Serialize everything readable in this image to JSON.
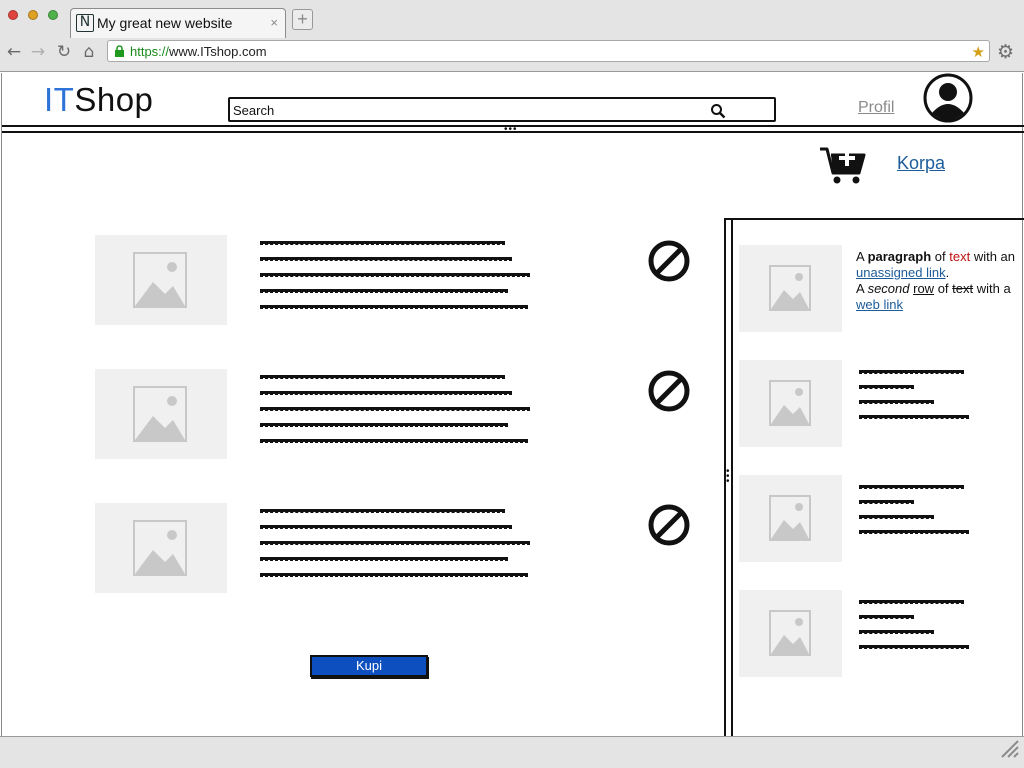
{
  "browser": {
    "tab_title": "My great new website",
    "tab_favicon_letter": "N",
    "tab_close": "×",
    "new_tab": "+",
    "url_protocol": "https://",
    "url_rest": "www.ITshop.com",
    "icons": [
      "back-icon",
      "forward-icon",
      "reload-icon",
      "home-icon",
      "lock-icon",
      "bookmark-star-icon",
      "settings-icon"
    ],
    "colors": {
      "close": "#e0443e",
      "minimize": "#dea123",
      "maximize": "#4fb14a"
    }
  },
  "header": {
    "logo_it": "IT",
    "logo_shop": "Shop",
    "search_placeholder": "Search",
    "profil_label": "Profil",
    "korpa_label": "Korpa"
  },
  "products": [
    {
      "image_icon": "image-placeholder-icon",
      "remove_icon": "no-entry-icon"
    },
    {
      "image_icon": "image-placeholder-icon",
      "remove_icon": "no-entry-icon"
    },
    {
      "image_icon": "image-placeholder-icon",
      "remove_icon": "no-entry-icon"
    }
  ],
  "kupi_label": "Kupi",
  "sidebar": {
    "paragraph": {
      "a1": "A ",
      "bold": "paragraph",
      "of1": " of ",
      "red": "text",
      "with1": " with an ",
      "link1": "unassigned link",
      "dot": ".",
      "a2": "A ",
      "italic": "second",
      "sp": " ",
      "underline": "row",
      "of2": " of ",
      "strike": "text",
      "with2": " with a ",
      "link2": "web link"
    },
    "items_count_label": ""
  },
  "accent_colors": {
    "logo_it": "#2e74d8",
    "link": "#1d5c9a",
    "button": "#0e4fbf",
    "red_text": "#c01010"
  }
}
